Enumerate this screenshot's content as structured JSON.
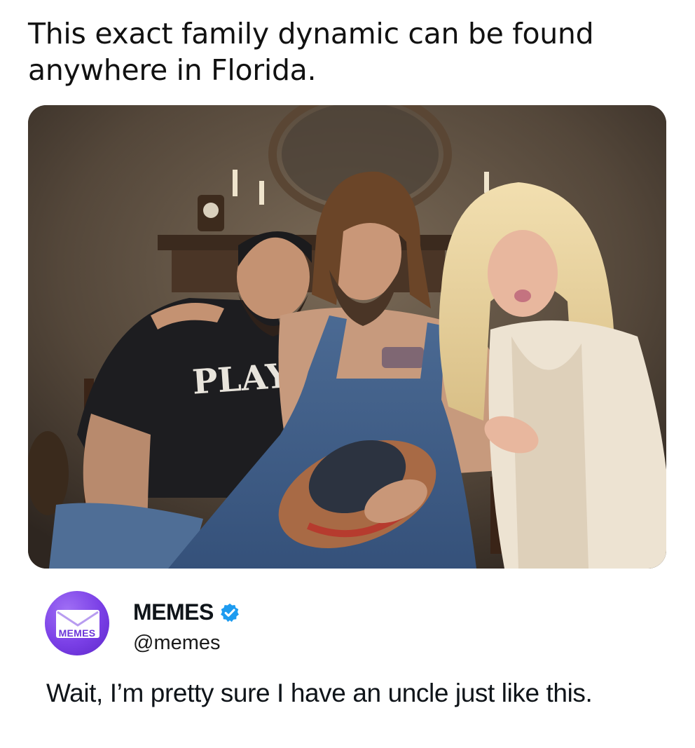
{
  "caption": "This exact family dynamic can be found anywhere in Florida.",
  "photo": {
    "shirt_text": "PLAY"
  },
  "author": {
    "name": "MEMES",
    "handle": "@memes",
    "avatar_label": "MEMES",
    "verified_icon": "verified-badge-icon",
    "avatar_color": "#7a3fe6",
    "verified_color": "#1d9bf0"
  },
  "tweet": {
    "text": "Wait, I’m pretty sure I have an uncle just like this."
  }
}
